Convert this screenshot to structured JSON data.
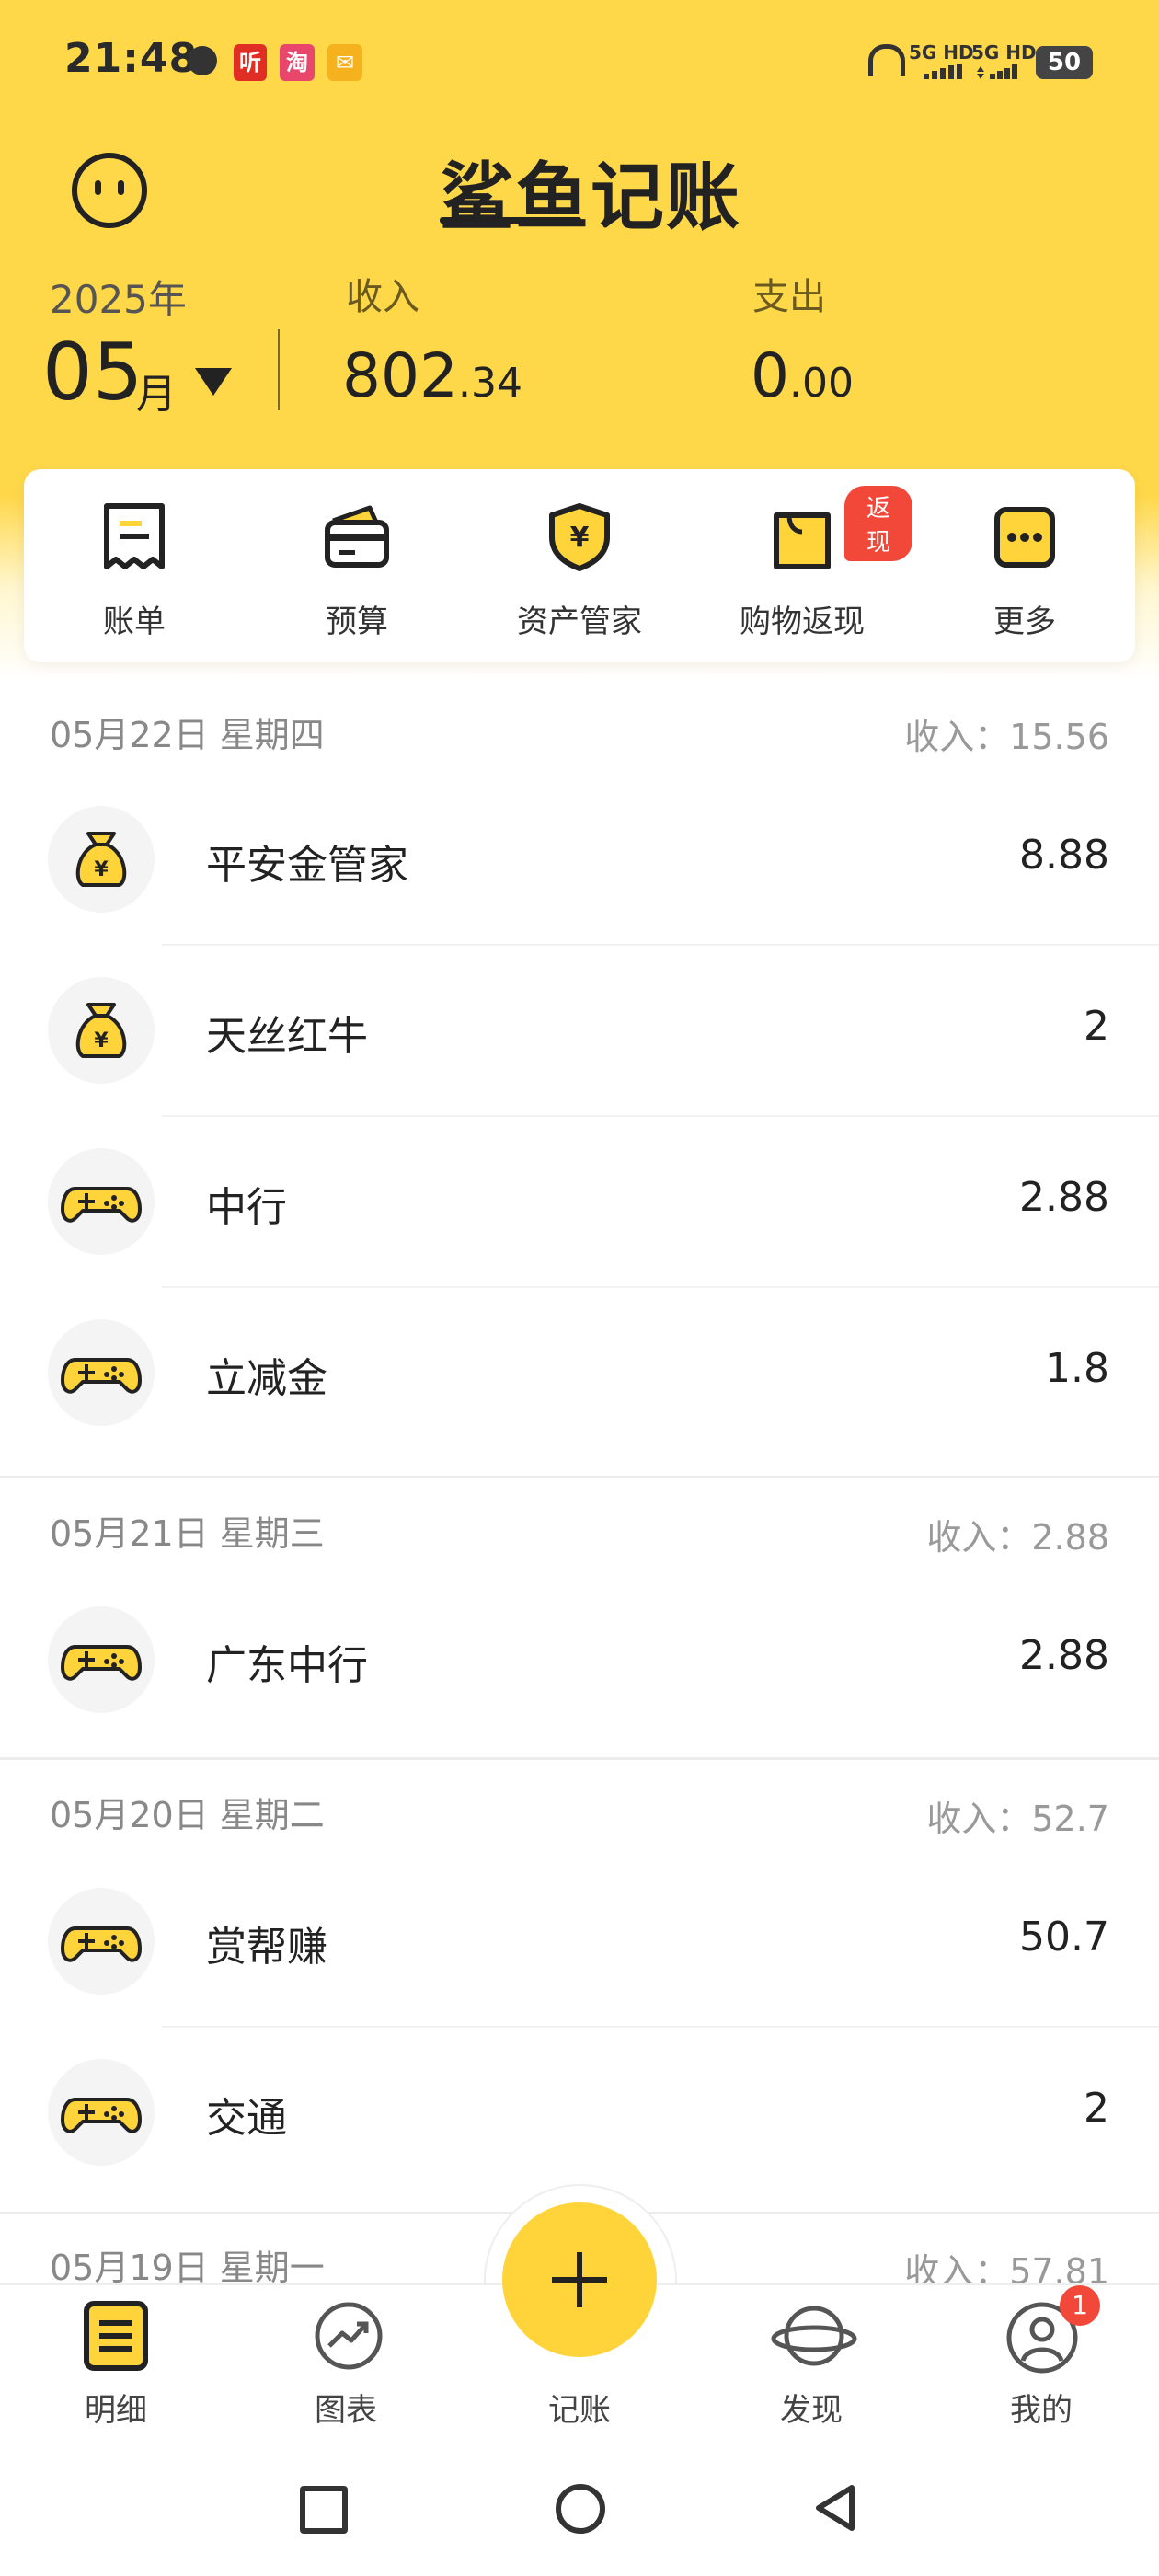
{
  "status_bar": {
    "time": "21:48",
    "notif_icons": [
      "globe-icon",
      "ting-app-icon",
      "taobao-app-icon",
      "mail-app-icon"
    ],
    "network_1": "5G HD",
    "network_2": "5G HD",
    "battery": "50"
  },
  "header": {
    "app_title": "鲨鱼记账",
    "year": "2025年",
    "month_num": "05",
    "month_unit": "月",
    "income_label": "收入",
    "income_int": "802",
    "income_dec": ".34",
    "expense_label": "支出",
    "expense_int": "0",
    "expense_dec": ".00"
  },
  "quick_menu": [
    {
      "label": "账单",
      "icon": "bill-icon"
    },
    {
      "label": "预算",
      "icon": "wallet-icon"
    },
    {
      "label": "资产管家",
      "icon": "asset-shield-icon"
    },
    {
      "label": "购物返现",
      "icon": "shopping-bag-icon",
      "badge": "返现"
    },
    {
      "label": "更多",
      "icon": "more-icon"
    }
  ],
  "days": [
    {
      "date": "05月22日 星期四",
      "summary": "收入：15.56",
      "items": [
        {
          "name": "平安金管家",
          "amount": "8.88",
          "icon": "money-bag-icon"
        },
        {
          "name": "天丝红牛",
          "amount": "2",
          "icon": "money-bag-icon"
        },
        {
          "name": "中行",
          "amount": "2.88",
          "icon": "gamepad-icon"
        },
        {
          "name": "立减金",
          "amount": "1.8",
          "icon": "gamepad-icon"
        }
      ]
    },
    {
      "date": "05月21日 星期三",
      "summary": "收入：2.88",
      "items": [
        {
          "name": "广东中行",
          "amount": "2.88",
          "icon": "gamepad-icon"
        }
      ]
    },
    {
      "date": "05月20日 星期二",
      "summary": "收入：52.7",
      "items": [
        {
          "name": "赏帮赚",
          "amount": "50.7",
          "icon": "gamepad-icon"
        },
        {
          "name": "交通",
          "amount": "2",
          "icon": "gamepad-icon"
        }
      ]
    },
    {
      "date": "05月19日 星期一",
      "summary": "收入：57.81",
      "items": []
    }
  ],
  "bottom_nav": [
    {
      "label": "明细",
      "icon": "detail-list-icon"
    },
    {
      "label": "图表",
      "icon": "chart-icon"
    },
    {
      "label": "记账",
      "icon": "plus-icon"
    },
    {
      "label": "发现",
      "icon": "planet-icon"
    },
    {
      "label": "我的",
      "icon": "profile-icon",
      "badge": "1"
    }
  ],
  "colors": {
    "brand_yellow": "#ffd84a",
    "badge_red": "#f2483a",
    "text_dark": "#222222",
    "text_muted": "#888888"
  }
}
